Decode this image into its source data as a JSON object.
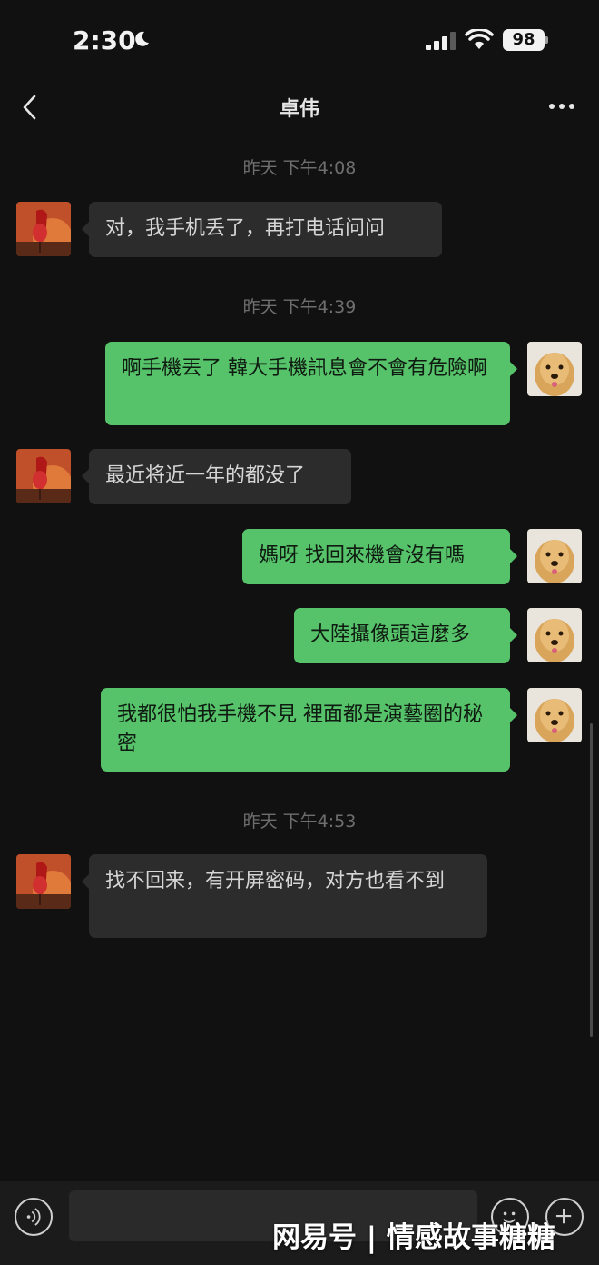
{
  "status_bar": {
    "time": "2:30",
    "battery": "98",
    "icons": [
      "moon-icon",
      "signal-icon",
      "wifi-icon",
      "battery-icon"
    ]
  },
  "nav": {
    "title": "卓伟",
    "back_icon": "chevron-left-icon",
    "more_icon": "more-dots-icon"
  },
  "colors": {
    "background": "#111111",
    "incoming_bubble": "#2c2c2c",
    "outgoing_bubble": "#56c26a",
    "timestamp_text": "#6e6e6e"
  },
  "messages": [
    {
      "type": "timestamp",
      "text": "昨天 下午4:08"
    },
    {
      "type": "incoming",
      "text": "对，我手机丢了，再打电话问问"
    },
    {
      "type": "timestamp",
      "text": "昨天 下午4:39"
    },
    {
      "type": "outgoing",
      "text": "啊手機丟了 韓大手機訊息會不會有危險啊"
    },
    {
      "type": "incoming",
      "text": "最近将近一年的都没了"
    },
    {
      "type": "outgoing",
      "text": "媽呀 找回來機會沒有嗎"
    },
    {
      "type": "outgoing",
      "text": "大陸攝像頭這麼多"
    },
    {
      "type": "outgoing",
      "text": "我都很怕我手機不見 裡面都是演藝圈的秘密"
    },
    {
      "type": "timestamp",
      "text": "昨天 下午4:53"
    },
    {
      "type": "incoming",
      "text": "找不回来，有开屏密码，对方也看不到"
    }
  ],
  "input_bar": {
    "voice_icon": "voice-icon",
    "emoji_icon": "emoji-icon",
    "plus_icon": "plus-icon",
    "value": ""
  },
  "watermark": "网易号 | 情感故事糖糖"
}
